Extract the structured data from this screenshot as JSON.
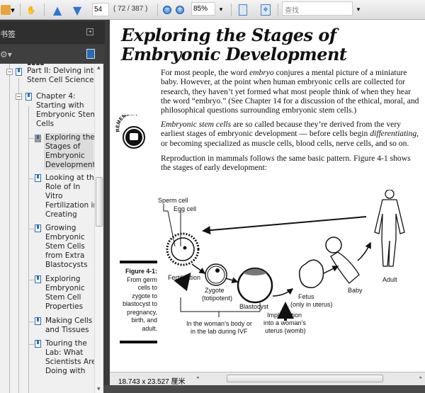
{
  "toolbar": {
    "page_number": "54",
    "page_count": "( 72 / 387 )",
    "zoom": "85%",
    "search_placeholder": "查找"
  },
  "sidebar": {
    "title": "书签",
    "tree": [
      {
        "label": "Part II: Delving into Stem Cell Science",
        "lines": [
          "Part II: Delving into",
          "Stem Cell Science"
        ]
      },
      {
        "label": "Chapter 4: Starting with Embryonic Stem Cells",
        "lines": [
          "Chapter 4:",
          "Starting with",
          "Embryonic Stem",
          "Cells"
        ]
      },
      {
        "label": "Exploring the Stages of Embryonic Development",
        "lines": [
          "Exploring the",
          "Stages of",
          "Embryonic",
          "Development"
        ],
        "selected": true
      },
      {
        "label": "Looking at the Role of In Vitro Fertilization in Creating",
        "lines": [
          "Looking at the",
          "Role of In",
          "Vitro",
          "Fertilization in",
          "Creating"
        ]
      },
      {
        "label": "Growing Embryonic Stem Cells from Extra Blastocysts",
        "lines": [
          "Growing",
          "Embryonic",
          "Stem Cells",
          "from Extra",
          "Blastocysts"
        ]
      },
      {
        "label": "Exploring Embryonic Stem Cell Properties",
        "lines": [
          "Exploring",
          "Embryonic",
          "Stem Cell",
          "Properties"
        ]
      },
      {
        "label": "Making Cells and Tissues",
        "lines": [
          "Making Cells",
          "and Tissues"
        ]
      },
      {
        "label": "Touring the Lab: What Scientists Are Doing with",
        "lines": [
          "Touring the",
          "Lab: What",
          "Scientists Are",
          "Doing with"
        ]
      }
    ]
  },
  "document": {
    "title_line1": "Exploring the Stages of",
    "title_line2": "Embryonic Development",
    "para1_a": "For most people, the word ",
    "para1_em": "embryo",
    "para1_b": " conjures a mental picture of a miniature baby. However, at the point when human embryonic cells are collected for research, they haven’t yet formed what most people think of when they hear the word “embryo.” (See Chapter 14 for a discussion of the ethical, moral, and philosophical questions surrounding embryonic stem cells.)",
    "remember_label": "REMEMBER",
    "para2_em": "Embryonic stem cells",
    "para2_a": " are so called because they’re derived from the very earliest stages of embryonic development — before cells begin ",
    "para2_em2": "differentiating,",
    "para2_b": " or becoming specialized as muscle cells, blood cells, nerve cells, and so on.",
    "para3": "Reproduction in mammals follows the same basic pattern. Figure 4-1 shows the stages of early development:",
    "figure": {
      "caption_title": "Figure 4-1:",
      "caption_text": "From germ cells to zygote to blastocyst to pregnancy, birth, and adult.",
      "labels": {
        "sperm": "Sperm cell",
        "egg": "Egg cell",
        "fertilization": "Fertilization",
        "zygote": "Zygote",
        "zygote_sub": "(totipotent)",
        "blastocyst": "Blastocyst",
        "fetus": "Fetus",
        "fetus_sub": "(only in uterus)",
        "baby": "Baby",
        "adult": "Adult",
        "ivf1": "In the woman’s body or",
        "ivf2": "in the lab during IVF",
        "impl1": "Implantation",
        "impl2": "into a woman’s",
        "impl3": "uterus (womb)"
      }
    }
  },
  "status": {
    "page_size": "18.743 x 23.527 厘米"
  }
}
